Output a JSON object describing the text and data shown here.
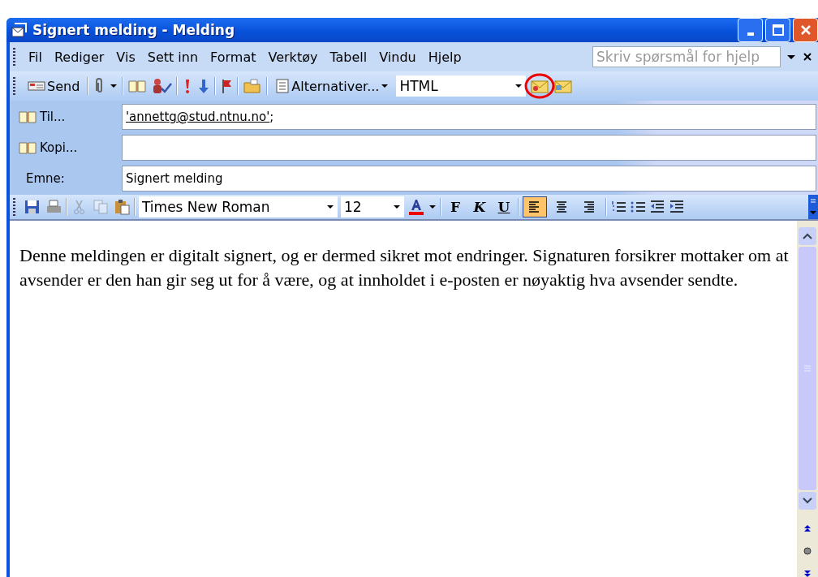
{
  "window": {
    "title": "Signert melding - Melding"
  },
  "menu": [
    "Fil",
    "Rediger",
    "Vis",
    "Sett inn",
    "Format",
    "Verktøy",
    "Tabell",
    "Vindu",
    "Hjelp"
  ],
  "help": {
    "placeholder": "Skriv spørsmål for hjelp"
  },
  "toolbar": {
    "send": "Send",
    "options": "Alternativer...",
    "format": "HTML",
    "sign_highlighted": true
  },
  "header_fields": [
    {
      "kind": "book",
      "label": "Til...",
      "value": "'annettg@stud.ntnu.no'",
      "suffix": ";"
    },
    {
      "kind": "book",
      "label": "Kopi..."
    },
    {
      "kind": "plain",
      "label": "Emne:",
      "value": "Signert melding"
    }
  ],
  "formatting": {
    "font": "Times New Roman",
    "size": "12",
    "standard": [
      {
        "kind": "save",
        "disabled": false
      },
      {
        "kind": "print",
        "disabled": false
      },
      {
        "kind": "cut",
        "disabled": true
      },
      {
        "kind": "copy",
        "disabled": true
      },
      {
        "kind": "paste",
        "disabled": false
      }
    ],
    "styles": [
      {
        "label": "F",
        "kind": "bold"
      },
      {
        "label": "K",
        "kind": "italic"
      },
      {
        "label": "U",
        "kind": "underline"
      }
    ],
    "alignment": [
      {
        "kind": "left",
        "selected": true
      },
      {
        "kind": "center",
        "selected": false
      },
      {
        "kind": "right",
        "selected": false
      }
    ]
  },
  "body": "Denne meldingen er digitalt signert, og er dermed sikret mot endringer. Signaturen forsikrer mottaker om at avsender er den han gir seg ut for å være, og at innholdet i e-posten er nøyaktig hva avsender sendte."
}
